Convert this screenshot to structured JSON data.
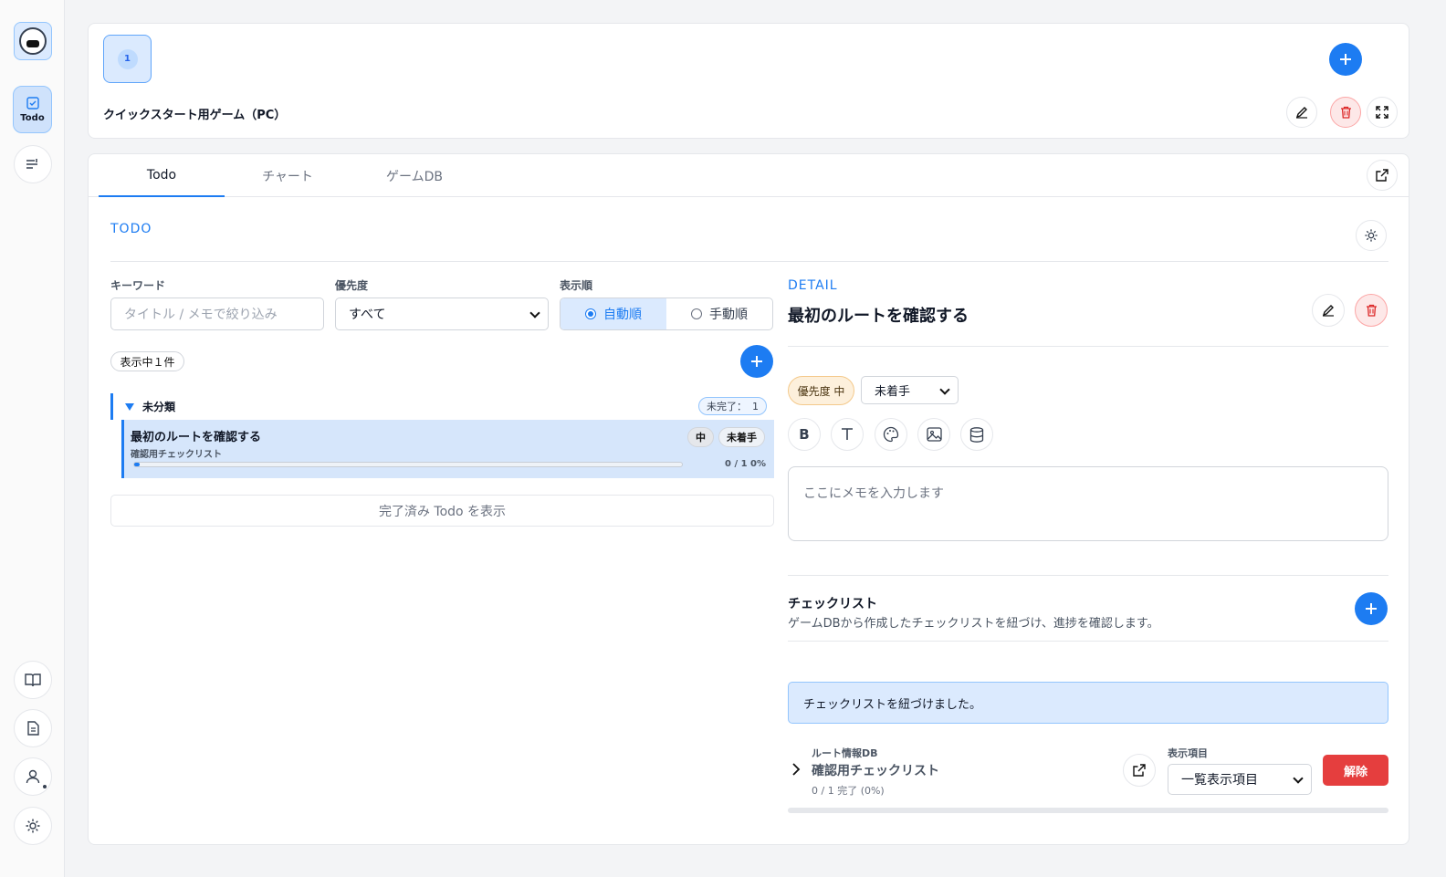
{
  "sidebar": {
    "todo_label": "Todo"
  },
  "game": {
    "chip_number": "1",
    "title": "クイックスタート用ゲーム（PC）"
  },
  "tabs": [
    {
      "label": "Todo",
      "active": true
    },
    {
      "label": "チャート",
      "active": false
    },
    {
      "label": "ゲームDB",
      "active": false
    }
  ],
  "todo_panel": {
    "section_label": "TODO",
    "keyword_label": "キーワード",
    "keyword_placeholder": "タイトル / メモで絞り込み",
    "priority_label": "優先度",
    "priority_value": "すべて",
    "order_label": "表示順",
    "order_options": [
      {
        "label": "自動順",
        "selected": true
      },
      {
        "label": "手動順",
        "selected": false
      }
    ],
    "count_text": "表示中１件",
    "group": {
      "name": "未分類",
      "incomplete_label": "未完了：",
      "incomplete_count": "1"
    },
    "item": {
      "title": "最初のルートを確認する",
      "subtitle": "確認用チェックリスト",
      "priority_badge": "中",
      "status_badge": "未着手",
      "progress_text": "0 / 1 0%",
      "progress_fraction": 0.01
    },
    "show_completed": "完了済み Todo を表示"
  },
  "detail": {
    "section_label": "DETAIL",
    "title": "最初のルートを確認する",
    "priority_chip": "優先度 中",
    "status_value": "未着手",
    "toolbar": [
      "bold-icon",
      "text-icon",
      "palette-icon",
      "image-icon",
      "database-icon"
    ],
    "memo_placeholder": "ここにメモを入力します",
    "checklist_title": "チェックリスト",
    "checklist_desc": "ゲームDBから作成したチェックリストを紐づけ、進捗を確認します。",
    "alert": "チェックリストを紐づけました。",
    "linked": {
      "source": "ルート情報DB",
      "name": "確認用チェックリスト",
      "progress": "0 / 1 完了 (0%)",
      "display_label": "表示項目",
      "display_value": "一覧表示項目",
      "unlink_label": "解除"
    }
  },
  "colors": {
    "accent": "#1d7cf2",
    "danger": "#e53e3e"
  }
}
